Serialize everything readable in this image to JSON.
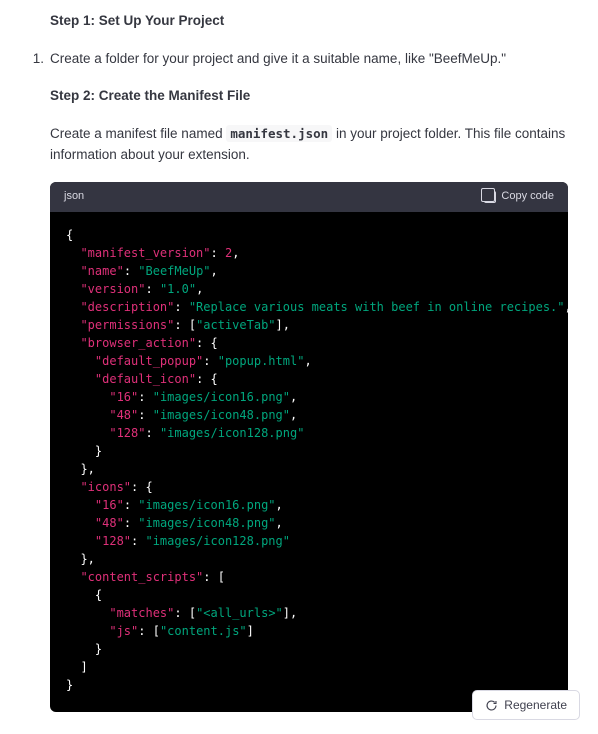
{
  "step1": {
    "heading": "Step 1: Set Up Your Project",
    "list_number": "1.",
    "list_text": "Create a folder for your project and give it a suitable name, like \"BeefMeUp.\""
  },
  "step2": {
    "heading": "Step 2: Create the Manifest File",
    "para_before": "Create a manifest file named ",
    "code_inline": "manifest.json",
    "para_after": " in your project folder. This file contains information about your extension."
  },
  "code": {
    "lang": "json",
    "copy_label": "Copy code"
  },
  "manifest": {
    "manifest_version": 2,
    "name": "BeefMeUp",
    "version": "1.0",
    "description": "Replace various meats with beef in online recipes.",
    "permissions": [
      "activeTab"
    ],
    "browser_action": {
      "default_popup": "popup.html",
      "default_icon": {
        "16": "images/icon16.png",
        "48": "images/icon48.png",
        "128": "images/icon128.png"
      }
    },
    "icons": {
      "16": "images/icon16.png",
      "48": "images/icon48.png",
      "128": "images/icon128.png"
    },
    "content_scripts": [
      {
        "matches": [
          "<all_urls>"
        ],
        "js": [
          "content.js"
        ]
      }
    ]
  },
  "regenerate_label": "Regenerate"
}
